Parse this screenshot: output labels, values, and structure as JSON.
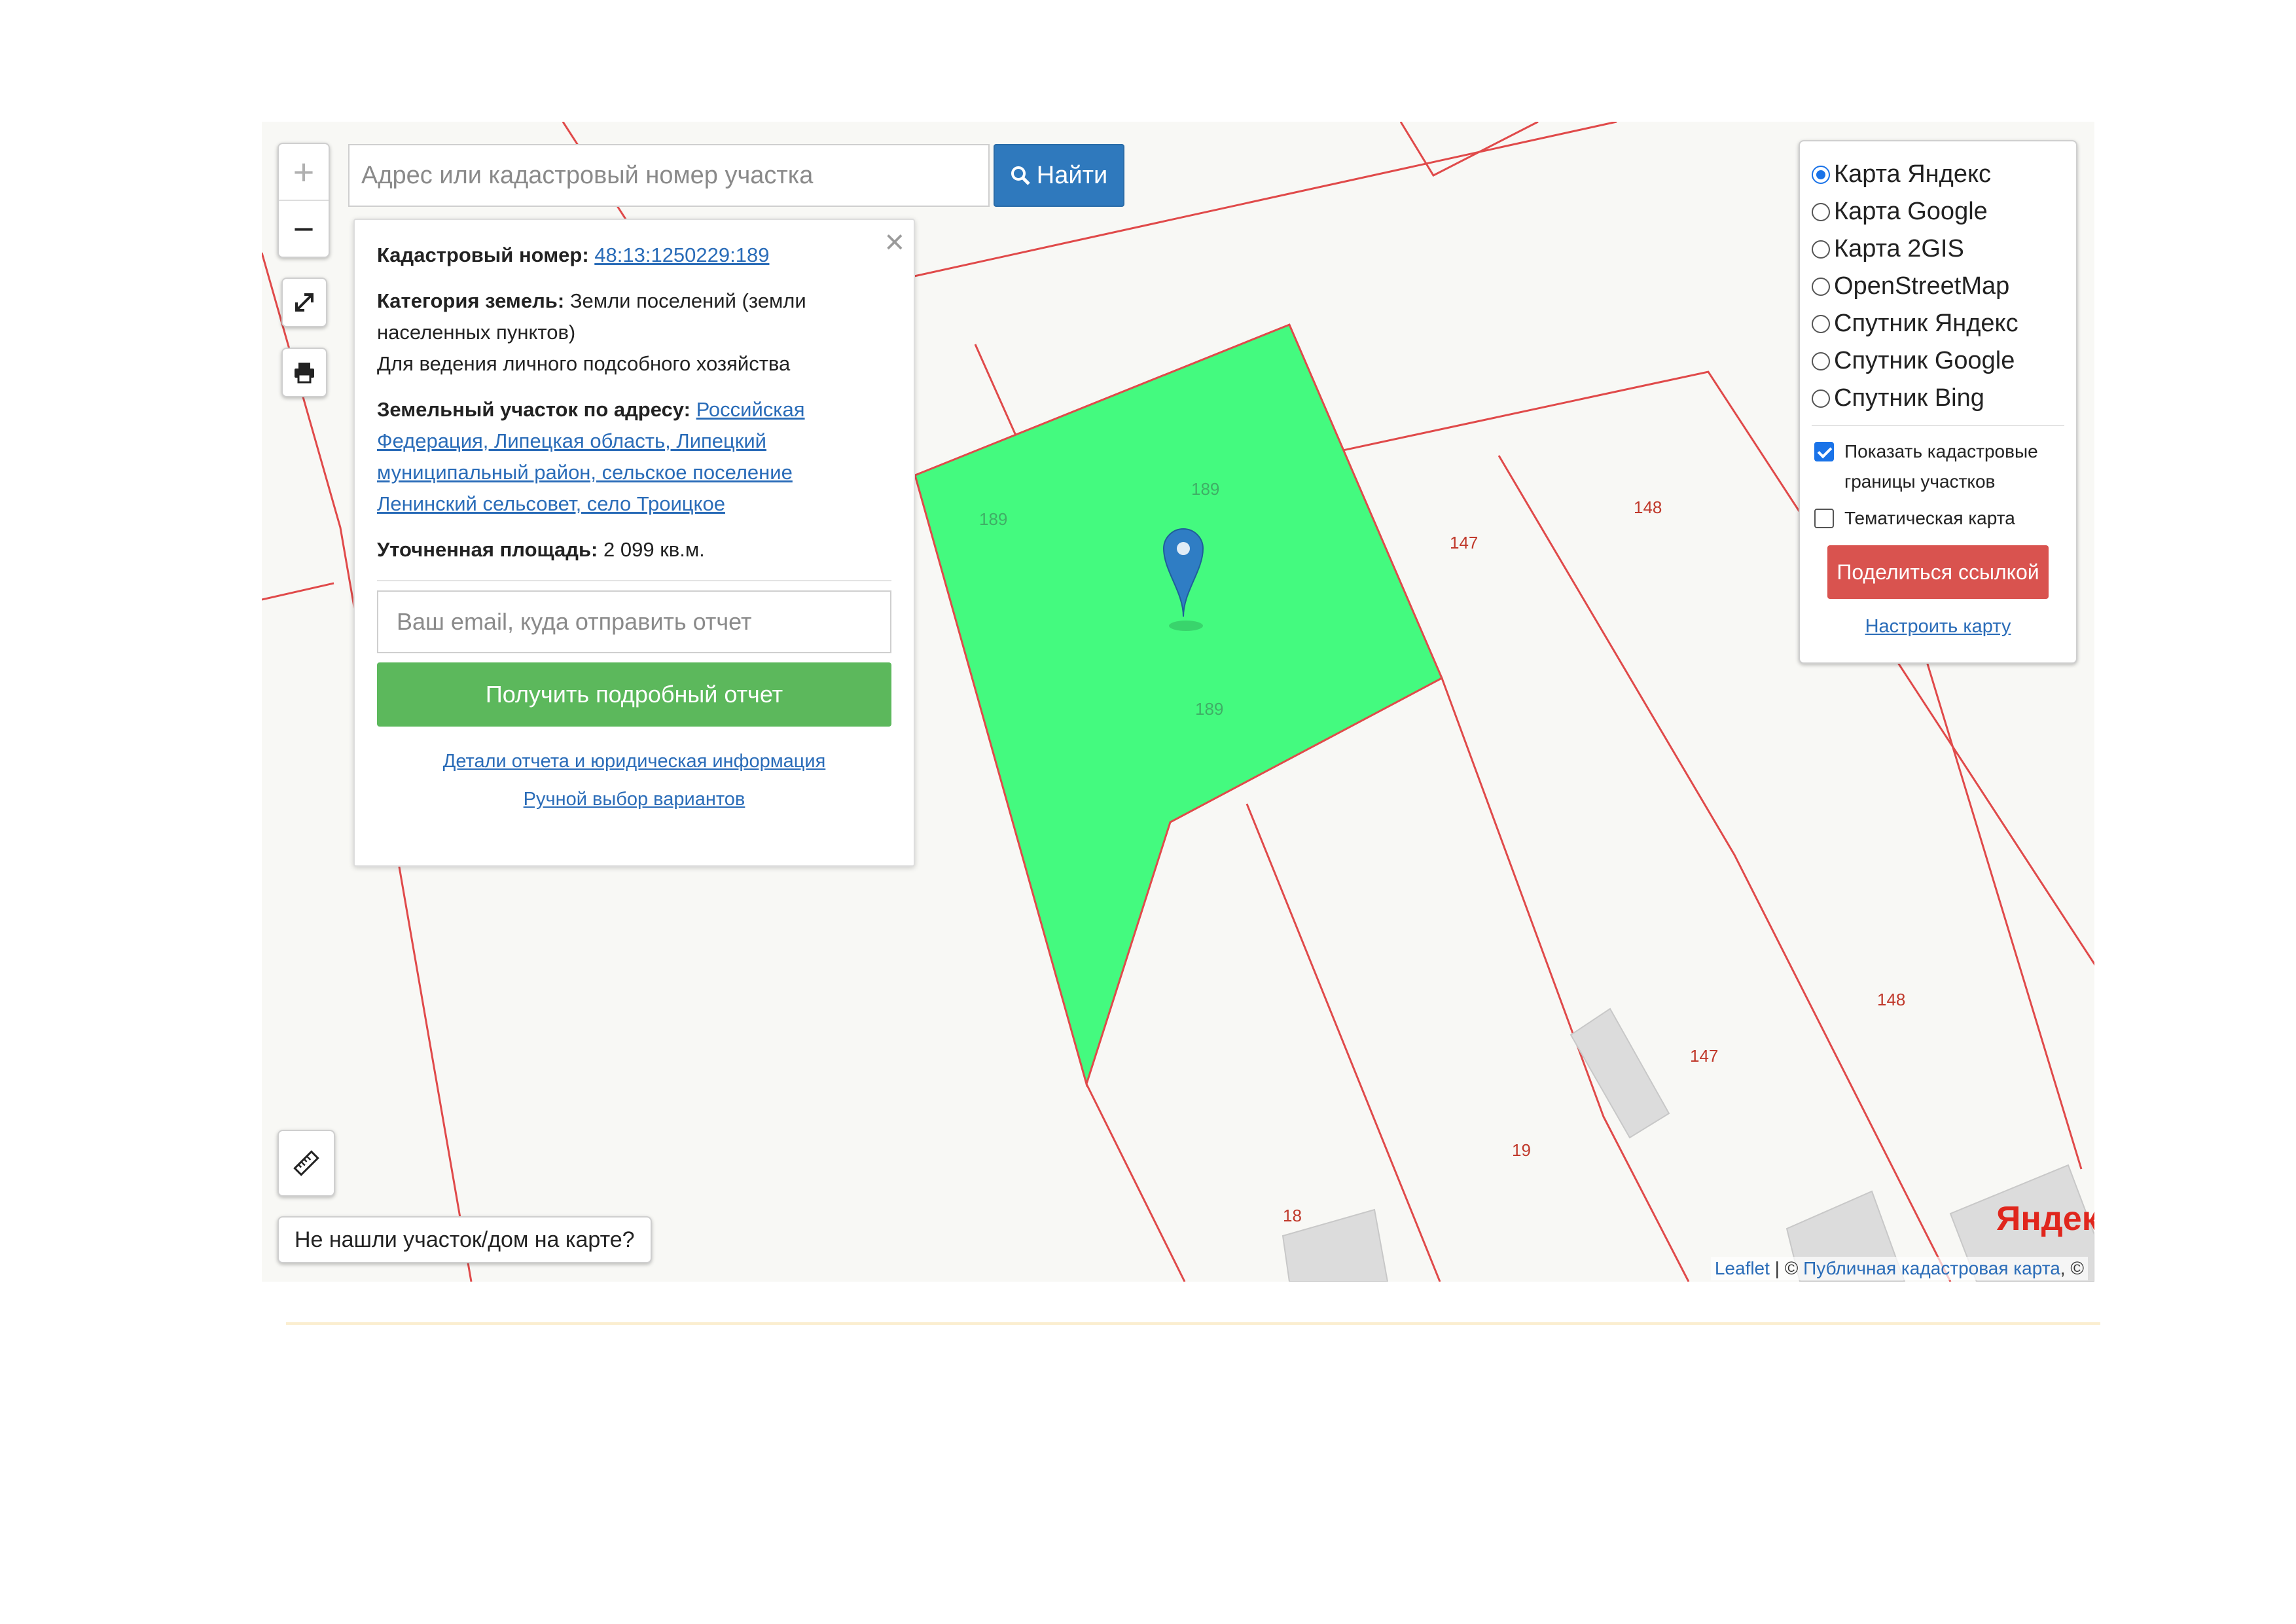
{
  "search": {
    "placeholder": "Адрес или кадастровый номер участка",
    "button_label": "Найти"
  },
  "zoom": {
    "in": "+",
    "out": "−"
  },
  "popup": {
    "cadastral_label": "Кадастровый номер:",
    "cadastral_value": "48:13:1250229:189",
    "category_label": "Категория земель:",
    "category_value": "Земли поселений (земли населенных пунктов)",
    "usage": "Для ведения личного подсобного хозяйства",
    "address_label": "Земельный участок по адресу:",
    "address_value": "Российская Федерация, Липецкая область, Липецкий муниципальный район, сельское поселение Ленинский сельсовет, село Троицкое",
    "area_label": "Уточненная площадь:",
    "area_value": "2 099",
    "area_unit": "кв.м.",
    "email_placeholder": "Ваш email, куда отправить отчет",
    "report_button": "Получить подробный отчет",
    "details_link": "Детали отчета и юридическая информация",
    "manual_link": "Ручной выбор вариантов"
  },
  "layers": {
    "options": [
      {
        "label": "Карта Яндекс",
        "selected": true
      },
      {
        "label": "Карта Google",
        "selected": false
      },
      {
        "label": "Карта 2GIS",
        "selected": false
      },
      {
        "label": "OpenStreetMap",
        "selected": false
      },
      {
        "label": "Спутник Яндекс",
        "selected": false
      },
      {
        "label": "Спутник Google",
        "selected": false
      },
      {
        "label": "Спутник Bing",
        "selected": false
      }
    ],
    "show_borders_label": "Показать кадастровые границы участков",
    "show_borders_checked": true,
    "thematic_label": "Тематическая карта",
    "thematic_checked": false,
    "share_button": "Поделиться ссылкой",
    "setup_link": "Настроить карту"
  },
  "not_found_label": "Не нашли участок/дом на карте?",
  "map_labels": {
    "p189_a": "189",
    "p189_b": "189",
    "p189_c": "189",
    "p147_a": "147",
    "p147_b": "147",
    "p148_a": "148",
    "p148_b": "148",
    "p19": "19",
    "p18": "18"
  },
  "attribution": {
    "leaflet": "Leaflet",
    "sep": " | © ",
    "pkk": "Публичная кадастровая карта",
    "tail": ", ©",
    "yandex_logo_first": "Я",
    "yandex_logo_rest": "ндекс"
  },
  "colors": {
    "parcel_fill": "#44fa7f",
    "parcel_border": "#e04a4a",
    "marker": "#2f7dc4",
    "search_btn": "#2f79bd",
    "report_btn": "#5cb85c",
    "share_btn": "#d9534f"
  }
}
